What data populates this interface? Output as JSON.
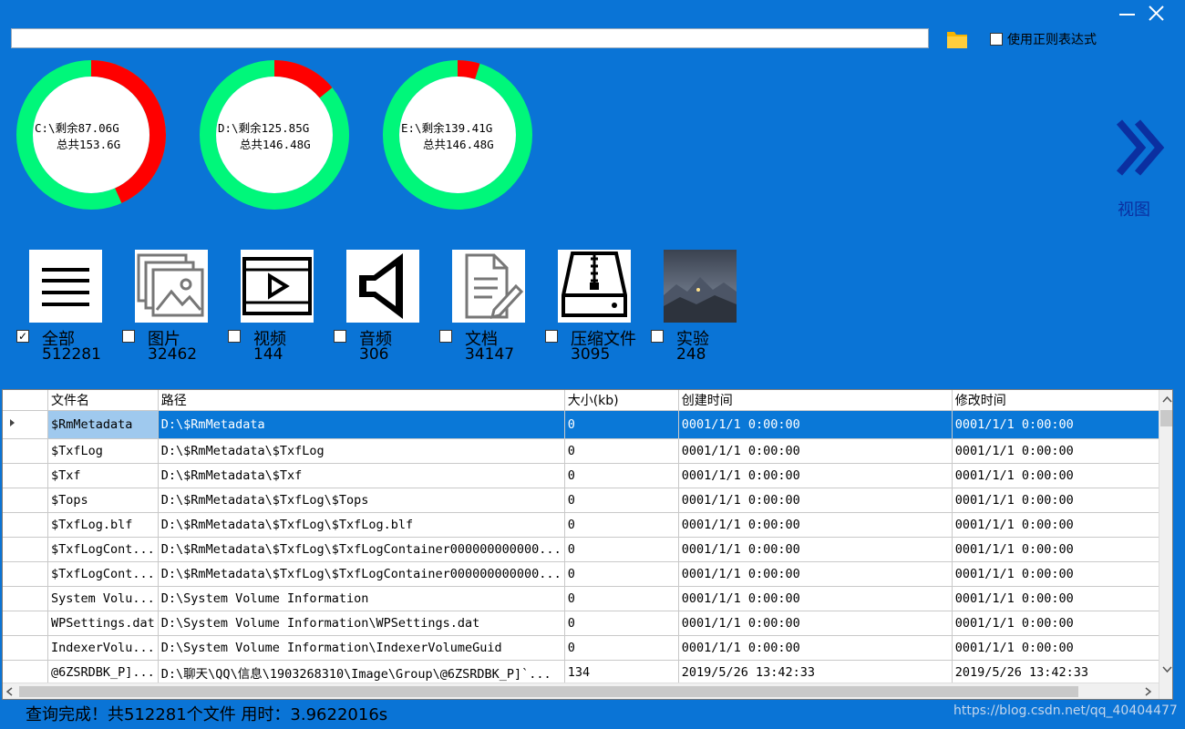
{
  "window": {
    "minimize_icon": "minimize-icon",
    "close_icon": "close-icon"
  },
  "search": {
    "value": "",
    "folder_icon": "folder-icon"
  },
  "regex": {
    "label": "使用正则表达式",
    "checked": false
  },
  "drives": [
    {
      "line1": "C:\\剩余87.06G",
      "line2": "总共153.6G",
      "free_gb": 87.06,
      "total_gb": 153.6
    },
    {
      "line1": "D:\\剩余125.85G",
      "line2": "总共146.48G",
      "free_gb": 125.85,
      "total_gb": 146.48
    },
    {
      "line1": "E:\\剩余139.41G",
      "line2": "总共146.48G",
      "free_gb": 139.41,
      "total_gb": 146.48
    }
  ],
  "colors": {
    "background": "#0a74d6",
    "free": "#00f77a",
    "used": "#ff0000",
    "selection": "#0a78d7",
    "view": "#0b2fa0"
  },
  "view": {
    "label": "视图",
    "icon": "double-chevron-right-icon"
  },
  "categories": [
    {
      "name": "全部",
      "count": "512281",
      "checked": true,
      "icon": "list-icon"
    },
    {
      "name": "图片",
      "count": "32462",
      "checked": false,
      "icon": "image-icon"
    },
    {
      "name": "视频",
      "count": "144",
      "checked": false,
      "icon": "video-icon"
    },
    {
      "name": "音频",
      "count": "306",
      "checked": false,
      "icon": "speaker-icon"
    },
    {
      "name": "文档",
      "count": "34147",
      "checked": false,
      "icon": "document-icon"
    },
    {
      "name": "压缩文件",
      "count": "3095",
      "checked": false,
      "icon": "zip-drive-icon"
    },
    {
      "name": "实验",
      "count": "248",
      "checked": false,
      "icon": "photo-thumbnail-icon"
    }
  ],
  "table": {
    "columns": [
      "文件名",
      "路径",
      "大小(kb)",
      "创建时间",
      "修改时间"
    ],
    "rows": [
      [
        "$RmMetadata",
        "D:\\$RmMetadata",
        "0",
        "0001/1/1 0:00:00",
        "0001/1/1 0:00:00"
      ],
      [
        "$TxfLog",
        "D:\\$RmMetadata\\$TxfLog",
        "0",
        "0001/1/1 0:00:00",
        "0001/1/1 0:00:00"
      ],
      [
        "$Txf",
        "D:\\$RmMetadata\\$Txf",
        "0",
        "0001/1/1 0:00:00",
        "0001/1/1 0:00:00"
      ],
      [
        "$Tops",
        "D:\\$RmMetadata\\$TxfLog\\$Tops",
        "0",
        "0001/1/1 0:00:00",
        "0001/1/1 0:00:00"
      ],
      [
        "$TxfLog.blf",
        "D:\\$RmMetadata\\$TxfLog\\$TxfLog.blf",
        "0",
        "0001/1/1 0:00:00",
        "0001/1/1 0:00:00"
      ],
      [
        "$TxfLogCont...",
        "D:\\$RmMetadata\\$TxfLog\\$TxfLogContainer000000000000...",
        "0",
        "0001/1/1 0:00:00",
        "0001/1/1 0:00:00"
      ],
      [
        "$TxfLogCont...",
        "D:\\$RmMetadata\\$TxfLog\\$TxfLogContainer000000000000...",
        "0",
        "0001/1/1 0:00:00",
        "0001/1/1 0:00:00"
      ],
      [
        "System Volu...",
        "D:\\System Volume Information",
        "0",
        "0001/1/1 0:00:00",
        "0001/1/1 0:00:00"
      ],
      [
        "WPSettings.dat",
        "D:\\System Volume Information\\WPSettings.dat",
        "0",
        "0001/1/1 0:00:00",
        "0001/1/1 0:00:00"
      ],
      [
        "IndexerVolu...",
        "D:\\System Volume Information\\IndexerVolumeGuid",
        "0",
        "0001/1/1 0:00:00",
        "0001/1/1 0:00:00"
      ],
      [
        "@6ZSRDBK_P]...",
        "D:\\聊天\\QQ\\信息\\1903268310\\Image\\Group\\@6ZSRDBK_P]`...",
        "134",
        "2019/5/26 13:42:33",
        "2019/5/26 13:42:33"
      ]
    ],
    "selected_row": 0
  },
  "status": "查询完成！共512281个文件 用时：3.9622016s",
  "watermark": "https://blog.csdn.net/qq_40404477"
}
